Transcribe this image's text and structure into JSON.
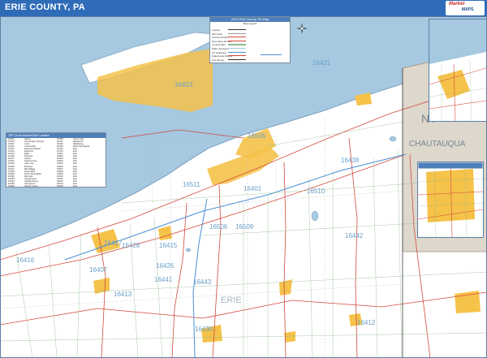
{
  "title": "ERIE COUNTY, PA",
  "logo": {
    "line1": "Market",
    "line2": "MAPS"
  },
  "county_label": "ERIE",
  "state_label": "NY",
  "chautauqua_label": "CHAUTAUQUA",
  "zip_labels": [
    "16509",
    "16510",
    "16511",
    "16505",
    "16506",
    "16415",
    "16417",
    "16421",
    "16423",
    "16426",
    "16428",
    "16430",
    "16438",
    "16441",
    "16442",
    "16443",
    "16401",
    "16407",
    "16412",
    "16413",
    "16416"
  ],
  "legend": {
    "title": "2016 Erie County, PA Map",
    "subtitle": "Map Legend",
    "rows_left": [
      "Legend",
      "ZIP Code",
      "Primary Routes",
      "Secondary Routes",
      "Local Roads",
      "Water Features",
      "US Highways",
      "State/Local Routes",
      "City Names"
    ],
    "rows_mid": [
      "Zip",
      "",
      "",
      "",
      "",
      "",
      "",
      "",
      ""
    ],
    "rows_right": [
      "Map Scale",
      "",
      "",
      "",
      "",
      "",
      "",
      "",
      ""
    ]
  },
  "zip_table": {
    "title": "ZIP Code Index/Grid Locator",
    "zips": [
      "16401",
      "16403",
      "16407",
      "16410",
      "16411",
      "16412",
      "16413",
      "16415",
      "16417",
      "16421",
      "16423",
      "16426",
      "16427",
      "16428",
      "16430",
      "16432",
      "16433",
      "16434",
      "16435",
      "16436",
      "16438",
      "16441",
      "16442",
      "16443",
      "16444",
      "16475",
      "16501",
      "16502",
      "16503",
      "16504",
      "16505",
      "16506",
      "16507",
      "16508",
      "16509",
      "16510",
      "16511",
      "16512",
      "16514",
      "16515",
      "16522",
      "16530",
      "16531",
      "16534",
      "16538",
      "16541",
      "16544",
      "16546",
      "16550",
      "16553",
      "16563",
      "16565"
    ],
    "cities": [
      "Albion",
      "Cambridge Springs",
      "Corry",
      "Cranesville",
      "East Springfield",
      "Edinboro",
      "Elgin",
      "Fairview",
      "Girard",
      "Harborcreek",
      "Lake City",
      "McKean",
      "Mill Village",
      "North East",
      "North Springfield",
      "Riceville",
      "Saegertown",
      "Spartansburg",
      "Springboro",
      "Spring Creek",
      "Union City",
      "Waterford",
      "Wattsburg",
      "West Springfield",
      "Erie",
      "Erie",
      "Erie",
      "Erie",
      "Erie",
      "Erie",
      "Erie",
      "Erie",
      "Erie",
      "Erie",
      "Erie",
      "Erie",
      "Erie",
      "Erie",
      "Erie",
      "Erie",
      "Erie",
      "Erie",
      "Erie",
      "Erie",
      "Erie",
      "Erie",
      "Erie",
      "Erie",
      "Erie",
      "Erie",
      "Erie",
      "Erie"
    ]
  },
  "colors": {
    "water": "#a6c8e0",
    "land": "#ffffff",
    "urban": "#f5c24a",
    "titlebar": "#2f6cb8",
    "ny": "#ddd7cc",
    "road": "#d44a3a"
  }
}
